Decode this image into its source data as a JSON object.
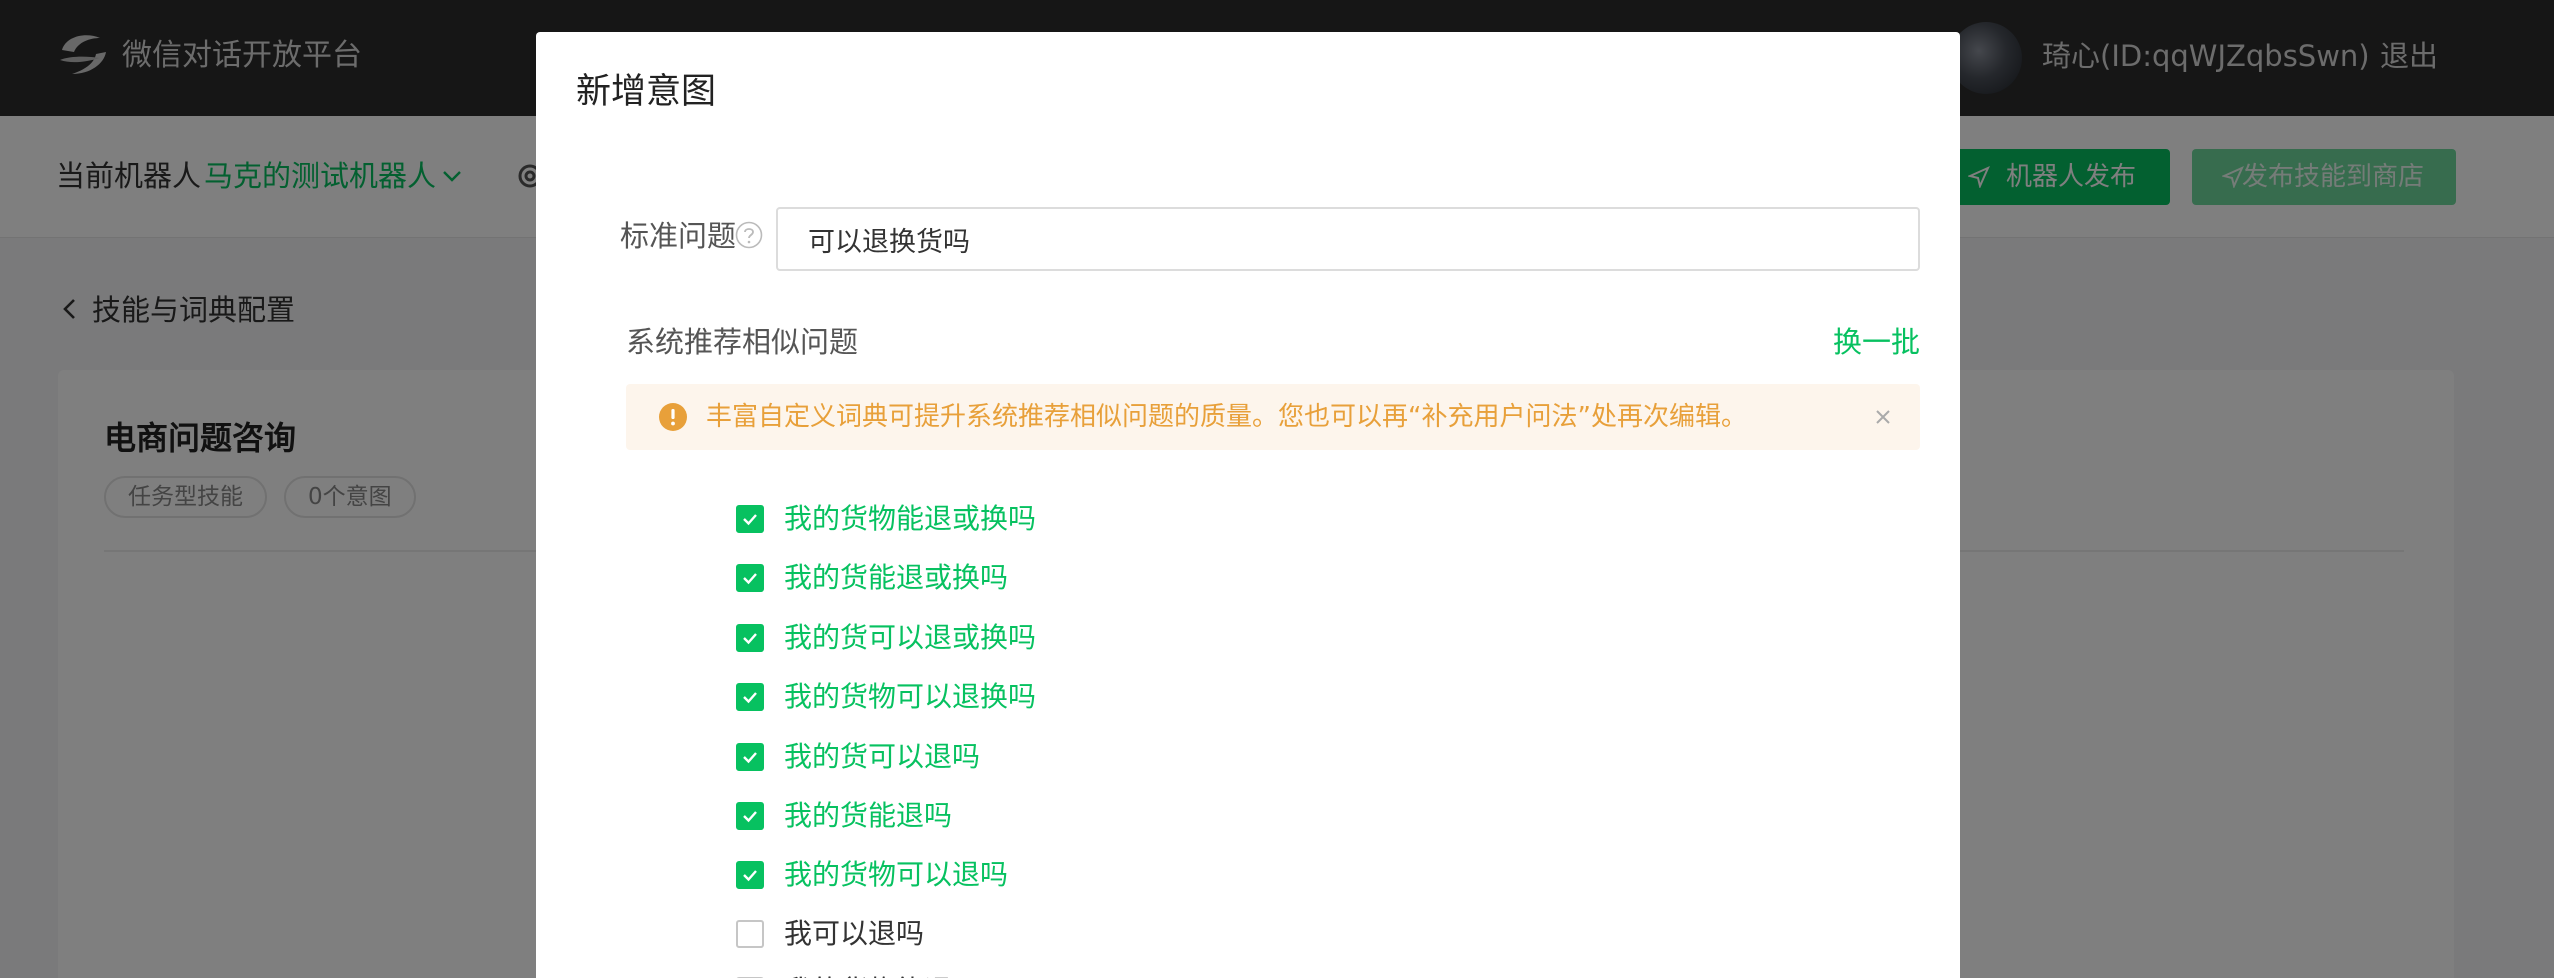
{
  "header": {
    "brand": "微信对话开放平台",
    "user": "琦心(ID:qqWJZqbsSwn)",
    "logout": "退出"
  },
  "robot_bar": {
    "current_label": "当前机器人",
    "robot_name": "马克的测试机器人",
    "publish_button": "机器人发布",
    "publish_store_button": "发布技能到商店"
  },
  "page": {
    "back_title": "技能与词典配置",
    "skill_name": "电商问题咨询",
    "tags": [
      "任务型技能",
      "0个意图"
    ]
  },
  "dialog": {
    "title": "新增意图",
    "standard_question_label": "标准问题",
    "standard_question_value": "可以退换货吗",
    "similar_label": "系统推荐相似问题",
    "refresh_link": "换一批",
    "notice": "丰富自定义词典可提升系统推荐相似问题的质量。您也可以再“补充用户问法”处再次编辑。",
    "suggestions": [
      {
        "text": "我的货物能退或换吗",
        "checked": true
      },
      {
        "text": "我的货能退或换吗",
        "checked": true
      },
      {
        "text": "我的货可以退或换吗",
        "checked": true
      },
      {
        "text": "我的货物可以退换吗",
        "checked": true
      },
      {
        "text": "我的货可以退吗",
        "checked": true
      },
      {
        "text": "我的货能退吗",
        "checked": true
      },
      {
        "text": "我的货物可以退吗",
        "checked": true
      },
      {
        "text": "我可以退吗",
        "checked": false
      },
      {
        "text": "我的货物能退吗",
        "checked": false
      }
    ]
  },
  "colors": {
    "accent": "#07c160",
    "warning": "#e8a03a",
    "topbar": "#2c2c2c"
  }
}
